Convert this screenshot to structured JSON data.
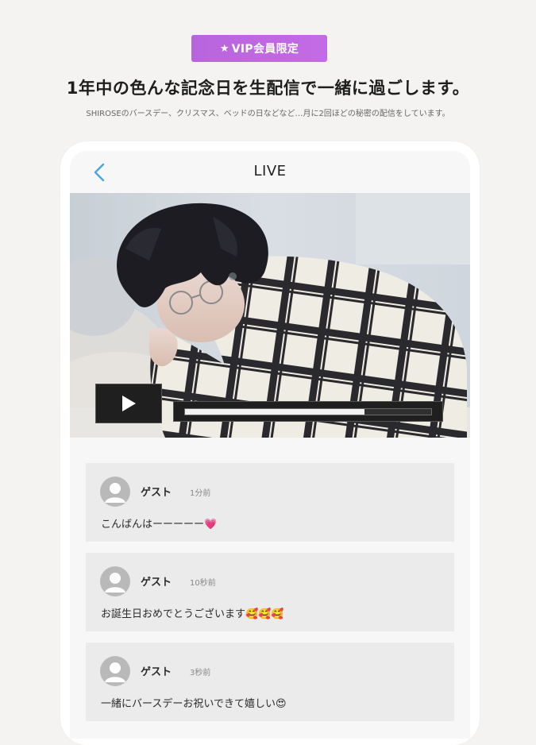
{
  "badge": {
    "icon": "star-icon",
    "label": "VIP会員限定",
    "color": "#c46ae6"
  },
  "headline": "1年中の色んな記念日を生配信で一緒に過ごします。",
  "subline": "SHIROSEのバースデー、クリスマス、ベッドの日などなど…月に2回ほどの秘密の配信をしています。",
  "screen": {
    "title": "LIVE",
    "back_icon": "chevron-left-icon",
    "accent_color": "#4aa6d8",
    "player": {
      "play_icon": "play-icon",
      "progress": 0.73
    },
    "comments": [
      {
        "name": "ゲスト",
        "time": "1分前",
        "text": "こんばんはーーーーー",
        "emoji": "💗"
      },
      {
        "name": "ゲスト",
        "time": "10秒前",
        "text": "お誕生日おめでとうございます",
        "emoji": "🥰🥰🥰"
      },
      {
        "name": "ゲスト",
        "time": "3秒前",
        "text": "一緒にバースデーお祝いできて嬉しい",
        "emoji": "😍"
      }
    ]
  }
}
